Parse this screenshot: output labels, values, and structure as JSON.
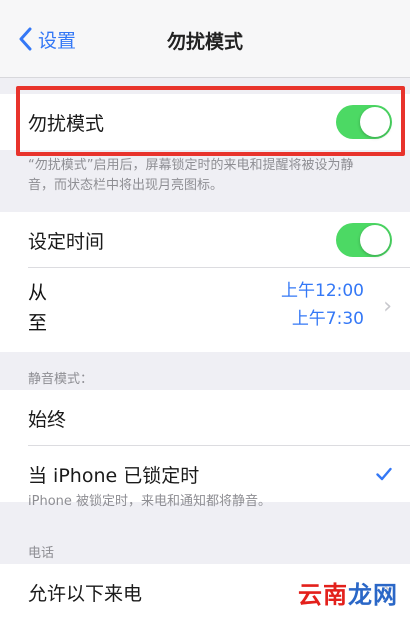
{
  "nav": {
    "back_label": "设置",
    "title": "勿扰模式"
  },
  "dnd": {
    "label": "勿扰模式",
    "enabled": true,
    "footnote": "“勿扰模式”启用后，屏幕锁定时的来电和提醒将被设为静音，而状态栏中将出现月亮图标。"
  },
  "schedule": {
    "label": "设定时间",
    "enabled": true,
    "from_label": "从",
    "to_label": "至",
    "from_time": "上午12:00",
    "to_time": "上午7:30"
  },
  "silence": {
    "header": "静音模式：",
    "always": "始终",
    "locked": "当 iPhone 已锁定时",
    "selected": "locked",
    "footnote": "iPhone 被锁定时，来电和通知都将静音。"
  },
  "phone": {
    "header": "电话",
    "allow_calls": "允许以下来电"
  },
  "watermark": {
    "part1": "云南",
    "part2": "龙网"
  },
  "colors": {
    "accent": "#3478f6",
    "toggle_on": "#4cd964",
    "highlight": "#e8332c"
  }
}
